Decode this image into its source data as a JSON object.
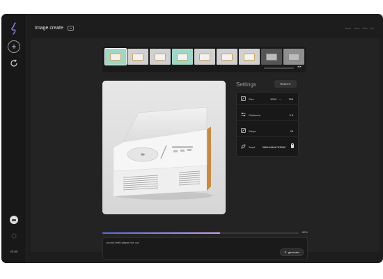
{
  "app": {
    "title": "Image create",
    "version": "v0.60"
  },
  "topnav": [
    "Home",
    "Docs",
    "Plus",
    "Sm"
  ],
  "thumbnails": [
    {
      "tone": "mint",
      "selected": true
    },
    {
      "tone": "grey",
      "selected": false
    },
    {
      "tone": "grey",
      "selected": false
    },
    {
      "tone": "mint",
      "selected": false
    },
    {
      "tone": "grey",
      "selected": false
    },
    {
      "tone": "grey",
      "selected": false
    },
    {
      "tone": "grey",
      "selected": false
    },
    {
      "tone": "dark",
      "selected": false
    },
    {
      "tone": "mid",
      "selected": false
    }
  ],
  "settings": {
    "title": "Settings",
    "reset_label": "Reset",
    "rows": [
      {
        "label": "Size",
        "icon": "size-icon",
        "width": "1024",
        "times": "×",
        "height": "768"
      },
      {
        "label": "Guidance",
        "icon": "guidance-icon",
        "value": "3.5"
      },
      {
        "label": "Steps",
        "icon": "steps-icon",
        "value": "28"
      },
      {
        "label": "Seed",
        "icon": "seed-icon",
        "value": "386464864763580"
      }
    ]
  },
  "progress": {
    "value": 0.6,
    "label": "60%"
  },
  "prompt": {
    "value": "pronut brett playne tot, vot",
    "generate_label": "generate"
  },
  "colors": {
    "background": "#1d1d1d",
    "panel": "#232323",
    "accent_start": "#5a6ad8",
    "accent_end": "#c7a2f1"
  }
}
